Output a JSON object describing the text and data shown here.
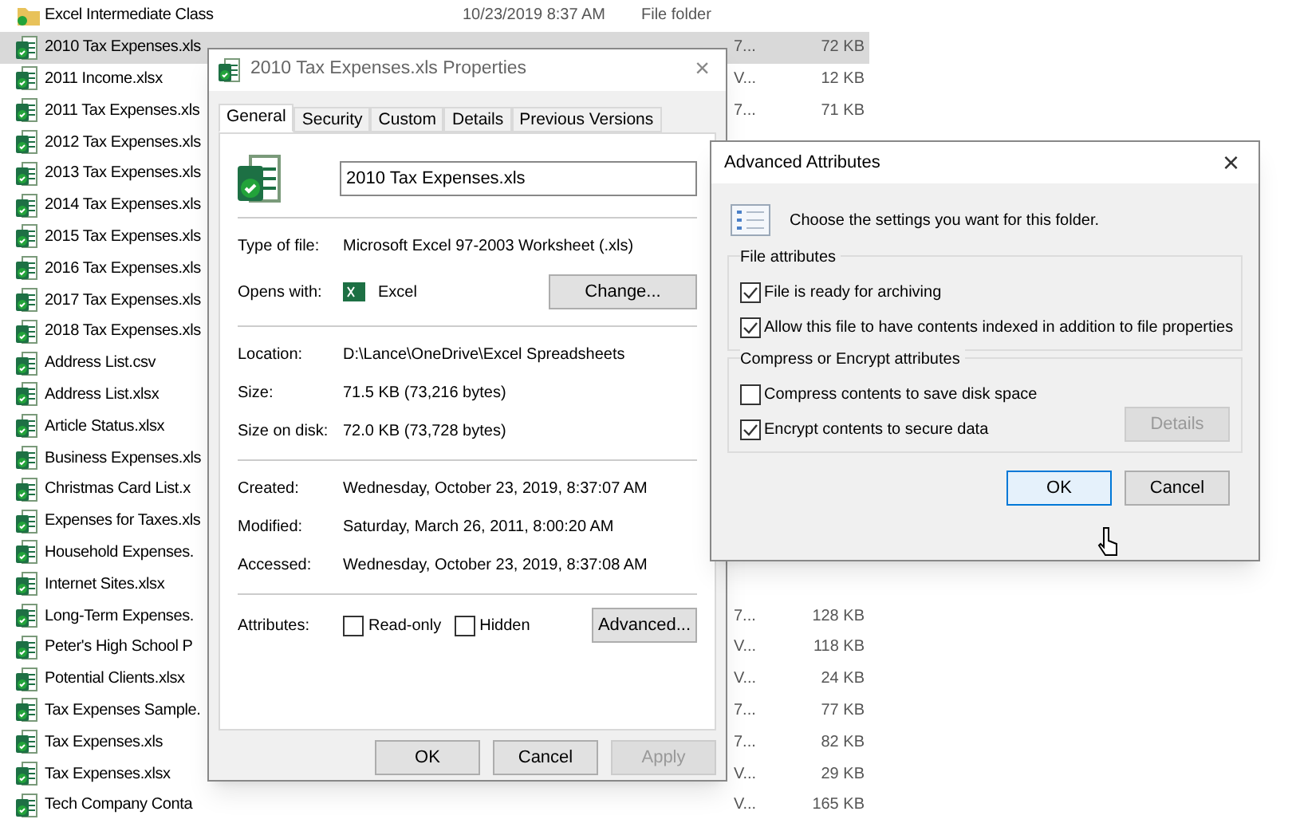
{
  "explorer": {
    "rows": [
      {
        "kind": "folder",
        "name": "Excel Intermediate Class",
        "date": "10/23/2019 8:37 AM",
        "type": "File folder",
        "selected": false
      },
      {
        "kind": "file",
        "name": "2010 Tax Expenses.xls",
        "type": "7...",
        "size": "72 KB",
        "selected": true
      },
      {
        "kind": "file",
        "name": "2011 Income.xlsx",
        "type": "V...",
        "size": "12 KB",
        "selected": false
      },
      {
        "kind": "file",
        "name": "2011 Tax Expenses.xls",
        "type": "7...",
        "size": "71 KB",
        "selected": false
      },
      {
        "kind": "file",
        "name": "2012 Tax Expenses.xls",
        "selected": false
      },
      {
        "kind": "file",
        "name": "2013 Tax Expenses.xls",
        "selected": false
      },
      {
        "kind": "file",
        "name": "2014 Tax Expenses.xls",
        "selected": false
      },
      {
        "kind": "file",
        "name": "2015 Tax Expenses.xls",
        "selected": false
      },
      {
        "kind": "file",
        "name": "2016 Tax Expenses.xls",
        "selected": false
      },
      {
        "kind": "file",
        "name": "2017 Tax Expenses.xls",
        "selected": false
      },
      {
        "kind": "file",
        "name": "2018 Tax Expenses.xls",
        "selected": false
      },
      {
        "kind": "file",
        "name": "Address List.csv",
        "selected": false
      },
      {
        "kind": "file",
        "name": "Address List.xlsx",
        "selected": false
      },
      {
        "kind": "file",
        "name": "Article Status.xlsx",
        "selected": false
      },
      {
        "kind": "file",
        "name": "Business Expenses.xls",
        "selected": false
      },
      {
        "kind": "file",
        "name": "Christmas Card List.x",
        "selected": false
      },
      {
        "kind": "file",
        "name": "Expenses for Taxes.xls",
        "selected": false
      },
      {
        "kind": "file",
        "name": "Household Expenses.",
        "selected": false
      },
      {
        "kind": "file",
        "name": "Internet Sites.xlsx",
        "selected": false
      },
      {
        "kind": "file",
        "name": "Long-Term Expenses.",
        "type": "7...",
        "size": "128 KB",
        "selected": false
      },
      {
        "kind": "file",
        "name": "Peter's High School P",
        "type": "V...",
        "size": "118 KB",
        "selected": false
      },
      {
        "kind": "file",
        "name": "Potential Clients.xlsx",
        "type": "V...",
        "size": "24 KB",
        "selected": false
      },
      {
        "kind": "file",
        "name": "Tax Expenses Sample.",
        "type": "7...",
        "size": "77 KB",
        "selected": false
      },
      {
        "kind": "file",
        "name": "Tax Expenses.xls",
        "type": "7...",
        "size": "82 KB",
        "selected": false
      },
      {
        "kind": "file",
        "name": "Tax Expenses.xlsx",
        "type": "V...",
        "size": "29 KB",
        "selected": false
      },
      {
        "kind": "file",
        "name": "Tech Company Conta",
        "type": "V...",
        "size": "165 KB",
        "selected": false
      }
    ]
  },
  "properties": {
    "title": "2010 Tax Expenses.xls Properties",
    "close": "×",
    "tabs": [
      {
        "label": "General",
        "selected": true
      },
      {
        "label": "Security",
        "selected": false
      },
      {
        "label": "Custom",
        "selected": false
      },
      {
        "label": "Details",
        "selected": false
      },
      {
        "label": "Previous Versions",
        "selected": false
      }
    ],
    "file_name": "2010 Tax Expenses.xls",
    "type_of_file": {
      "label": "Type of file:",
      "value": "Microsoft Excel 97-2003 Worksheet (.xls)"
    },
    "opens_with": {
      "label": "Opens with:",
      "value": "Excel",
      "button": "Change..."
    },
    "location_group": [
      {
        "label": "Location:",
        "value": "D:\\Lance\\OneDrive\\Excel Spreadsheets"
      },
      {
        "label": "Size:",
        "value": "71.5 KB (73,216 bytes)"
      },
      {
        "label": "Size on disk:",
        "value": "72.0 KB (73,728 bytes)"
      }
    ],
    "dates_group": [
      {
        "label": "Created:",
        "value": "Wednesday, October 23, 2019, 8:37:07 AM"
      },
      {
        "label": "Modified:",
        "value": "Saturday, March 26, 2011, 8:00:20 AM"
      },
      {
        "label": "Accessed:",
        "value": "Wednesday, October 23, 2019, 8:37:08 AM"
      }
    ],
    "attributes": {
      "label": "Attributes:",
      "options": [
        {
          "label": "Read-only",
          "checked": false
        },
        {
          "label": "Hidden",
          "checked": false
        }
      ],
      "button": "Advanced..."
    },
    "buttons": [
      {
        "label": "OK",
        "disabled": false
      },
      {
        "label": "Cancel",
        "disabled": false
      },
      {
        "label": "Apply",
        "disabled": true
      }
    ]
  },
  "advanced": {
    "title": "Advanced Attributes",
    "close": "×",
    "description": "Choose the settings you want for this folder.",
    "groups": [
      {
        "title": "File attributes",
        "options": [
          {
            "label": "File is ready for archiving",
            "checked": true
          },
          {
            "label": "Allow this file to have contents indexed in addition to file properties",
            "checked": true
          }
        ]
      },
      {
        "title": "Compress or Encrypt attributes",
        "options": [
          {
            "label": "Compress contents to save disk space",
            "checked": false
          },
          {
            "label": "Encrypt contents to secure data",
            "checked": true
          }
        ],
        "button": {
          "label": "Details",
          "disabled": true
        }
      }
    ],
    "buttons": [
      {
        "label": "OK",
        "focused": true
      },
      {
        "label": "Cancel",
        "focused": false
      }
    ]
  }
}
